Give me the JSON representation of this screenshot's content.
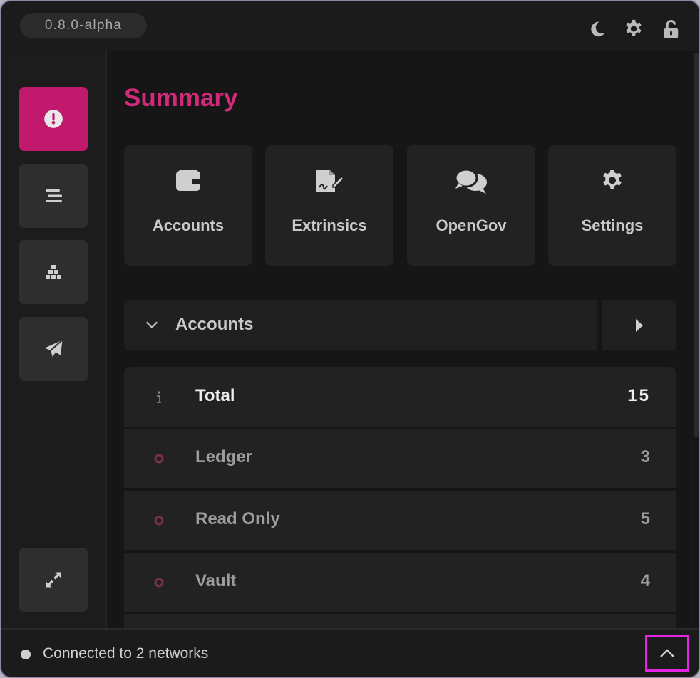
{
  "header": {
    "version": "0.8.0-alpha",
    "icons": [
      "moon-icon",
      "gear-icon",
      "unlock-icon"
    ]
  },
  "sidebar": {
    "items": [
      {
        "name": "summary",
        "icon": "gauge-icon",
        "active": true
      },
      {
        "name": "accounts-list",
        "icon": "list-icon",
        "active": false
      },
      {
        "name": "stacks",
        "icon": "boxes-icon",
        "active": false
      },
      {
        "name": "send",
        "icon": "paper-plane-icon",
        "active": false
      }
    ],
    "bottom_icon": "expand-icon"
  },
  "main": {
    "title": "Summary",
    "cards": [
      {
        "label": "Accounts",
        "icon": "wallet-icon"
      },
      {
        "label": "Extrinsics",
        "icon": "file-signature-icon"
      },
      {
        "label": "OpenGov",
        "icon": "comments-icon"
      },
      {
        "label": "Settings",
        "icon": "gear-icon"
      }
    ],
    "accounts_section": {
      "title": "Accounts",
      "rows": [
        {
          "label": "Total",
          "value": "15"
        },
        {
          "label": "Ledger",
          "value": "3"
        },
        {
          "label": "Read Only",
          "value": "5"
        },
        {
          "label": "Vault",
          "value": "4"
        }
      ]
    }
  },
  "footer": {
    "status": "Connected to 2 networks"
  },
  "colors": {
    "accent": "#d22a7a",
    "active_button": "#c11a6d",
    "highlight_box": "#e324e0",
    "background": "#171717"
  }
}
